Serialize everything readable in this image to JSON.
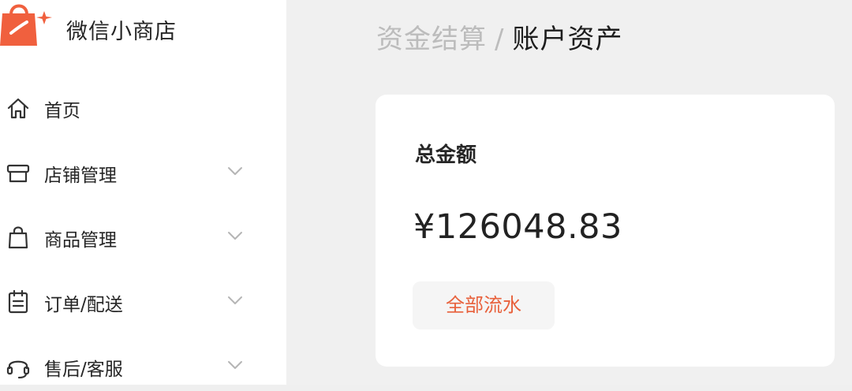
{
  "app": {
    "name": "微信小商店",
    "logo_icon": "shopping-bag-icon",
    "brand_color": "#f0603e"
  },
  "sidebar": {
    "items": [
      {
        "label": "首页",
        "icon": "home-icon",
        "expandable": false
      },
      {
        "label": "店铺管理",
        "icon": "store-icon",
        "expandable": true
      },
      {
        "label": "商品管理",
        "icon": "bag-icon",
        "expandable": true
      },
      {
        "label": "订单/配送",
        "icon": "order-list-icon",
        "expandable": true
      },
      {
        "label": "售后/客服",
        "icon": "headset-icon",
        "expandable": true
      }
    ]
  },
  "breadcrumb": {
    "parent": "资金结算",
    "separator": "/",
    "current": "账户资产"
  },
  "account_card": {
    "title": "总金额",
    "amount": "¥126048.83",
    "button_label": "全部流水",
    "button_color": "#e8613c"
  }
}
